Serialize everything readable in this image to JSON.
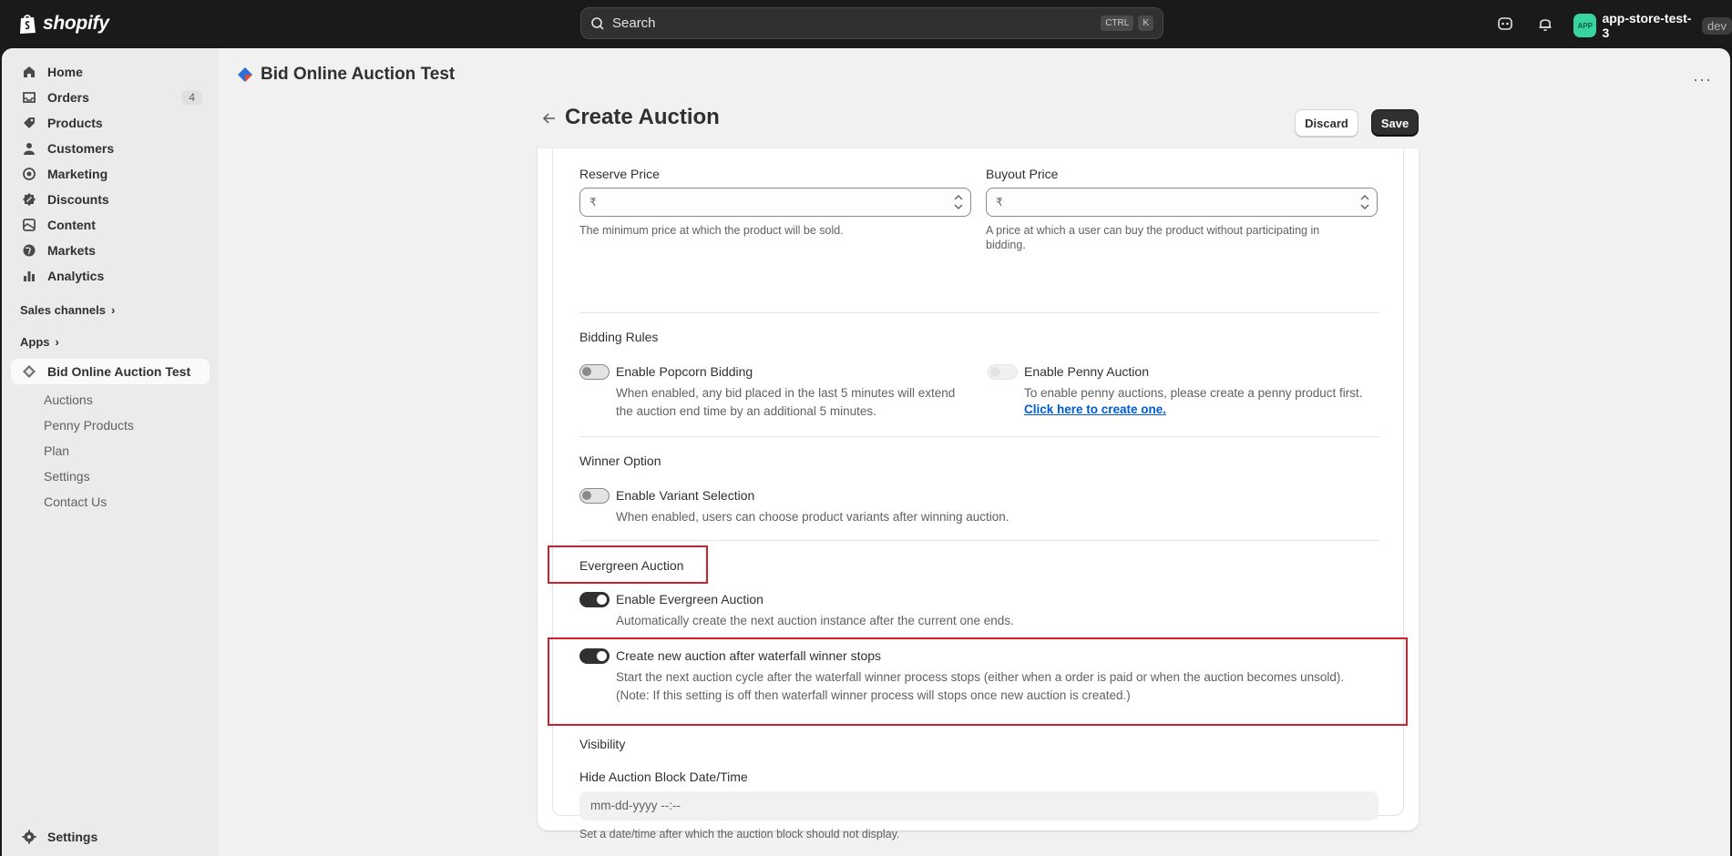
{
  "topbar": {
    "brand": "shopify",
    "search_placeholder": "Search",
    "kbd_ctrl": "CTRL",
    "kbd_k": "K",
    "account_avatar": "APP",
    "account_name": "app-store-test-3",
    "account_badge": "dev"
  },
  "sidebar": {
    "items": [
      {
        "label": "Home",
        "icon": "home-icon"
      },
      {
        "label": "Orders",
        "icon": "orders-icon",
        "count": "4"
      },
      {
        "label": "Products",
        "icon": "tag-icon"
      },
      {
        "label": "Customers",
        "icon": "person-icon"
      },
      {
        "label": "Marketing",
        "icon": "target-icon"
      },
      {
        "label": "Discounts",
        "icon": "discount-icon"
      },
      {
        "label": "Content",
        "icon": "content-icon"
      },
      {
        "label": "Markets",
        "icon": "globe-icon"
      },
      {
        "label": "Analytics",
        "icon": "bar-chart-icon"
      }
    ],
    "sales_channels": "Sales channels",
    "apps": "Apps",
    "app_name": "Bid Online Auction Test",
    "app_subitems": [
      "Auctions",
      "Penny Products",
      "Plan",
      "Settings",
      "Contact Us"
    ],
    "settings": "Settings"
  },
  "app_header": {
    "title": "Bid Online Auction Test"
  },
  "page": {
    "title": "Create Auction",
    "discard": "Discard",
    "save": "Save"
  },
  "form": {
    "reserve_price": {
      "label": "Reserve Price",
      "currency": "₹",
      "help": "The minimum price at which the product will be sold."
    },
    "buyout_price": {
      "label": "Buyout Price",
      "currency": "₹",
      "help_line1": "A price at which a user can buy the product without participating in",
      "help_line2": "bidding."
    },
    "bidding_rules": {
      "heading": "Bidding Rules",
      "popcorn_label": "Enable Popcorn Bidding",
      "popcorn_desc_line1": "When enabled, any bid placed in the last 5 minutes will extend",
      "popcorn_desc_line2": "the auction end time by an additional 5 minutes.",
      "penny_label": "Enable Penny Auction",
      "penny_desc": "To enable penny auctions, please create a penny product first.",
      "penny_link": "Click here to create one."
    },
    "winner_option": {
      "heading": "Winner Option",
      "variant_label": "Enable Variant Selection",
      "variant_desc": "When enabled, users can choose product variants after winning auction."
    },
    "evergreen": {
      "heading": "Evergreen Auction",
      "enable_label": "Enable Evergreen Auction",
      "enable_desc": "Automatically create the next auction instance after the current one ends.",
      "waterfall_label": "Create new auction after waterfall winner stops",
      "waterfall_desc_line1": "Start the next auction cycle after the waterfall winner process stops (either when a order is paid or when the auction becomes unsold).",
      "waterfall_desc_line2": "(Note: If this setting is off then waterfall winner process will stops once new auction is created.)"
    },
    "visibility": {
      "heading": "Visibility",
      "hide_label": "Hide Auction Block Date/Time",
      "hide_placeholder": "mm-dd-yyyy --:--",
      "hide_help": "Set a date/time after which the auction block should not display."
    }
  },
  "colors": {
    "highlight": "#d0202a",
    "link": "#005bd3",
    "toggle_on": "#303030"
  }
}
